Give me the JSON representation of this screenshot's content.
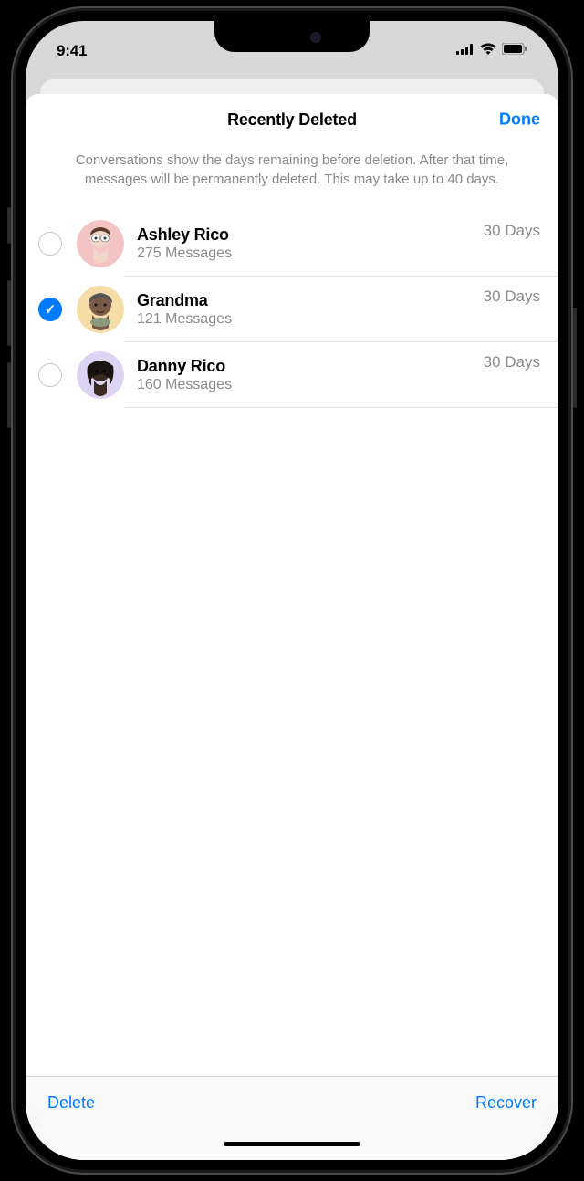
{
  "status": {
    "time": "9:41"
  },
  "header": {
    "title": "Recently Deleted",
    "done": "Done"
  },
  "info": "Conversations show the days remaining before deletion. After that time, messages will be permanently deleted. This may take up to 40 days.",
  "conversations": [
    {
      "name": "Ashley Rico",
      "sub": "275 Messages",
      "days": "30 Days",
      "selected": false,
      "avatar_bg": "#f4c4c4"
    },
    {
      "name": "Grandma",
      "sub": "121 Messages",
      "days": "30 Days",
      "selected": true,
      "avatar_bg": "#f6dca6"
    },
    {
      "name": "Danny Rico",
      "sub": "160 Messages",
      "days": "30 Days",
      "selected": false,
      "avatar_bg": "#dcd4f2"
    }
  ],
  "toolbar": {
    "delete": "Delete",
    "recover": "Recover"
  }
}
